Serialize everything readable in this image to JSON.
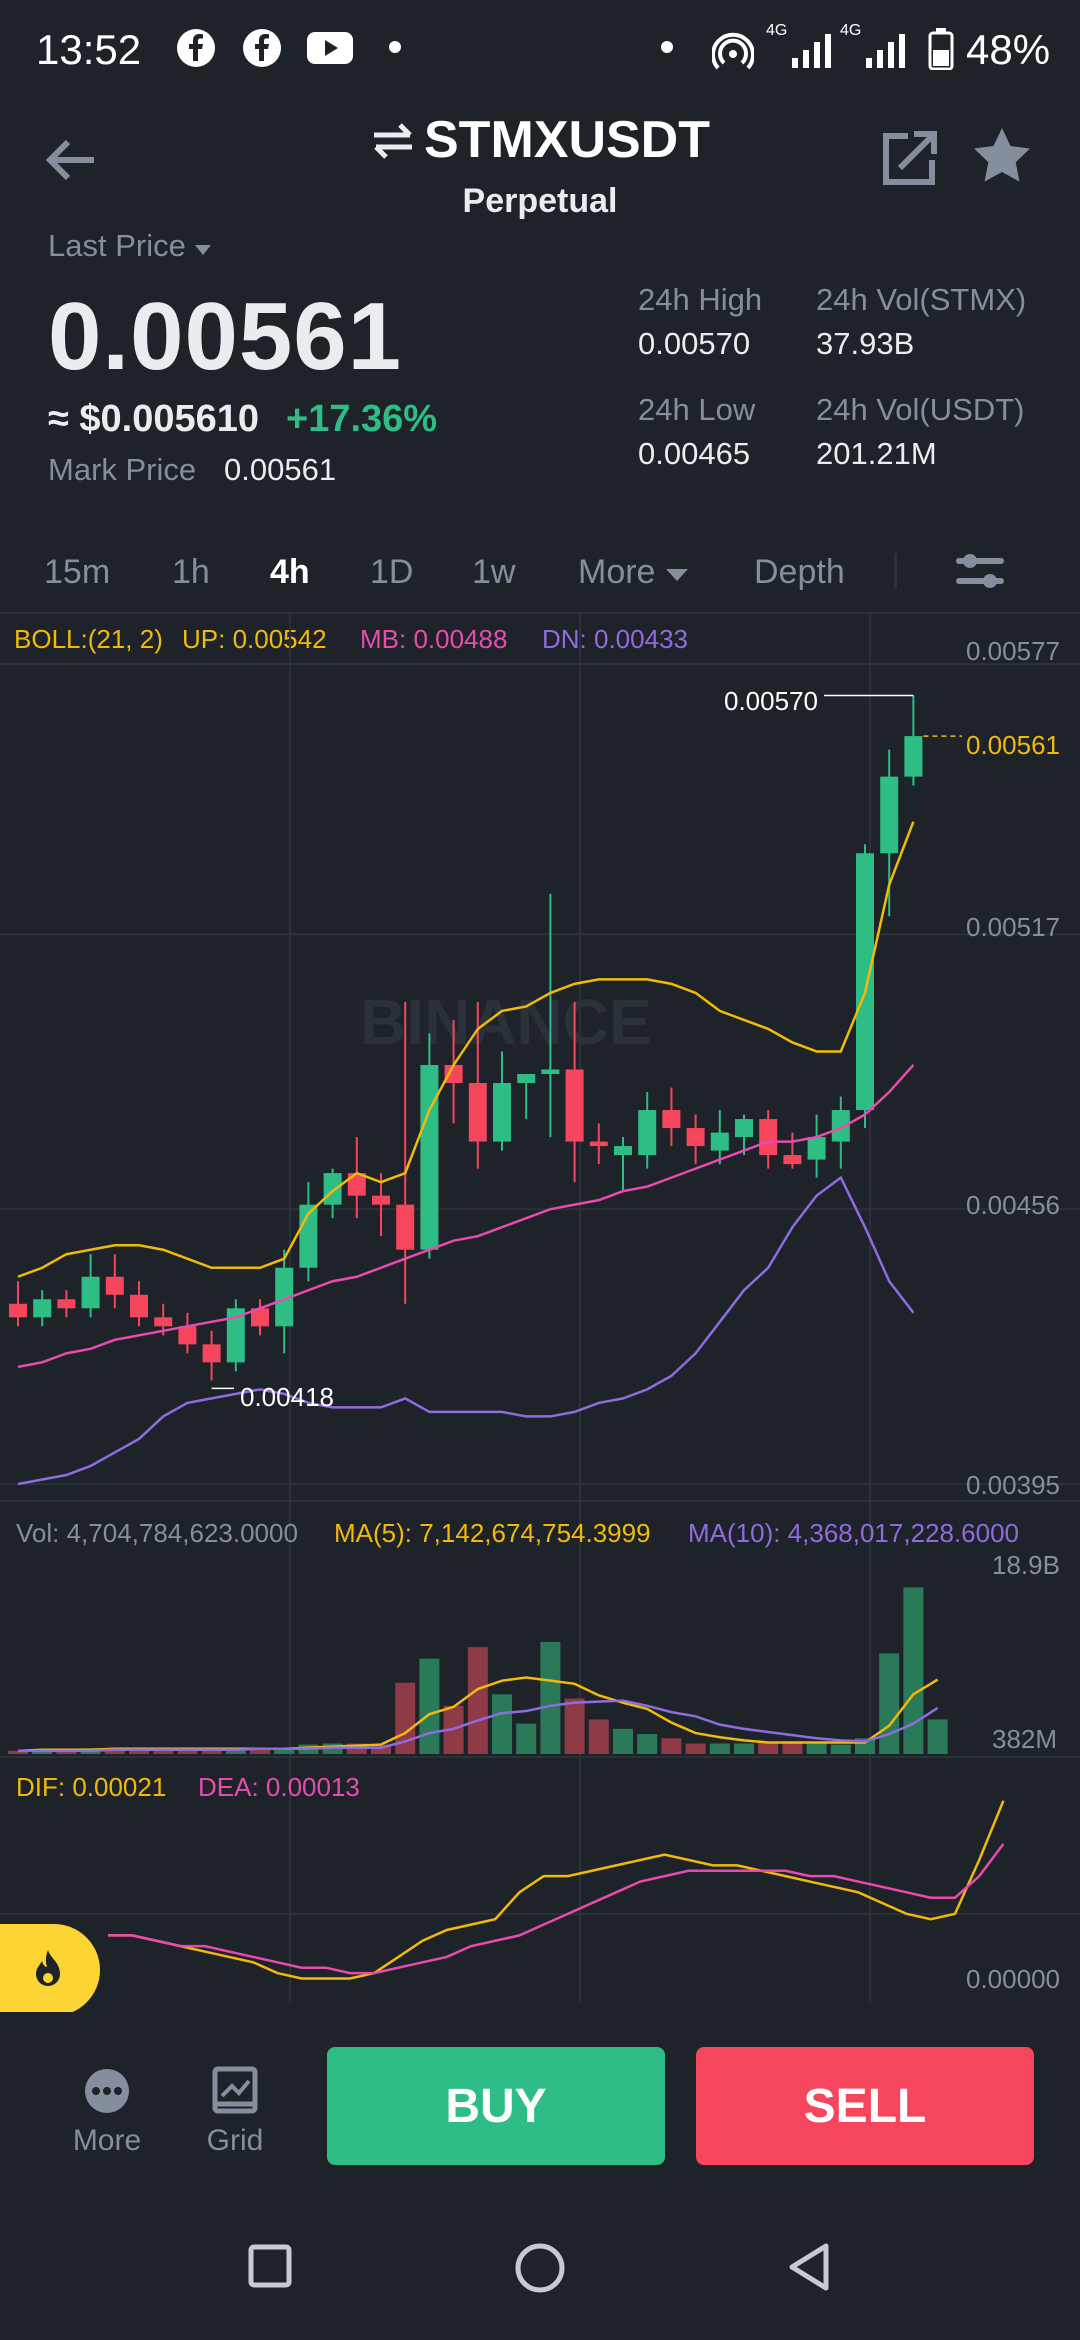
{
  "status_bar": {
    "time": "13:52",
    "battery": "48%",
    "net1": "4G",
    "net2": "4G"
  },
  "header": {
    "pair": "STMXUSDT",
    "contract": "Perpetual"
  },
  "ticker": {
    "last_price_label": "Last Price",
    "last_price": "0.00561",
    "fiat": "≈ $0.005610",
    "change": "+17.36%",
    "mark_price_label": "Mark Price",
    "mark_price": "0.00561",
    "high_label": "24h High",
    "high": "0.00570",
    "low_label": "24h Low",
    "low": "0.00465",
    "vol_base_label": "24h Vol(STMX)",
    "vol_base": "37.93B",
    "vol_quote_label": "24h Vol(USDT)",
    "vol_quote": "201.21M"
  },
  "intervals": {
    "m15": "15m",
    "h1": "1h",
    "h4": "4h",
    "d1": "1D",
    "w1": "1w",
    "more": "More",
    "depth": "Depth",
    "active": "4h"
  },
  "indicators": {
    "boll": "BOLL:(21, 2)",
    "up": "UP: 0.00542",
    "mb": "MB: 0.00488",
    "dn": "DN: 0.00433",
    "vol": "Vol: 4,704,784,623.0000",
    "ma5": "MA(5): 7,142,674,754.3999",
    "ma10": "MA(10): 4,368,017,228.6000",
    "dif": "DIF: 0.00021",
    "dea": "DEA: 0.00013"
  },
  "watermark": "BINANCE",
  "colors": {
    "up": "#2ebd85",
    "down": "#f6465d",
    "accent": "#fcd535",
    "boll_up": "#f0b90b",
    "boll_mb": "#e84bb0",
    "boll_dn": "#8f6be0"
  },
  "chart_data": {
    "type": "candlestick",
    "price_axis_ticks": [
      "0.00577",
      "0.00517",
      "0.00456",
      "0.00395"
    ],
    "ylim": [
      0.00395,
      0.00577
    ],
    "high_annotation": "0.00570",
    "low_annotation": "0.00418",
    "last_price_tag": "0.00561",
    "candles": [
      {
        "o": 0.00435,
        "h": 0.0044,
        "l": 0.0043,
        "c": 0.00432
      },
      {
        "o": 0.00432,
        "h": 0.00438,
        "l": 0.0043,
        "c": 0.00436
      },
      {
        "o": 0.00436,
        "h": 0.00438,
        "l": 0.00432,
        "c": 0.00434
      },
      {
        "o": 0.00434,
        "h": 0.00446,
        "l": 0.00432,
        "c": 0.00441
      },
      {
        "o": 0.00441,
        "h": 0.00446,
        "l": 0.00434,
        "c": 0.00437
      },
      {
        "o": 0.00437,
        "h": 0.0044,
        "l": 0.0043,
        "c": 0.00432
      },
      {
        "o": 0.00432,
        "h": 0.00435,
        "l": 0.00428,
        "c": 0.0043
      },
      {
        "o": 0.0043,
        "h": 0.00433,
        "l": 0.00424,
        "c": 0.00426
      },
      {
        "o": 0.00426,
        "h": 0.00429,
        "l": 0.00418,
        "c": 0.00422
      },
      {
        "o": 0.00422,
        "h": 0.00436,
        "l": 0.0042,
        "c": 0.00434
      },
      {
        "o": 0.00434,
        "h": 0.00436,
        "l": 0.00428,
        "c": 0.0043
      },
      {
        "o": 0.0043,
        "h": 0.00447,
        "l": 0.00424,
        "c": 0.00443
      },
      {
        "o": 0.00443,
        "h": 0.00462,
        "l": 0.0044,
        "c": 0.00457
      },
      {
        "o": 0.00457,
        "h": 0.00465,
        "l": 0.00454,
        "c": 0.00464
      },
      {
        "o": 0.00464,
        "h": 0.00472,
        "l": 0.00454,
        "c": 0.00459
      },
      {
        "o": 0.00459,
        "h": 0.00464,
        "l": 0.0045,
        "c": 0.00457
      },
      {
        "o": 0.00457,
        "h": 0.00502,
        "l": 0.00435,
        "c": 0.00447
      },
      {
        "o": 0.00447,
        "h": 0.00495,
        "l": 0.00445,
        "c": 0.00488
      },
      {
        "o": 0.00488,
        "h": 0.00498,
        "l": 0.00475,
        "c": 0.00484
      },
      {
        "o": 0.00484,
        "h": 0.00502,
        "l": 0.00465,
        "c": 0.00471
      },
      {
        "o": 0.00471,
        "h": 0.00491,
        "l": 0.00469,
        "c": 0.00484
      },
      {
        "o": 0.00484,
        "h": 0.00486,
        "l": 0.00476,
        "c": 0.00486
      },
      {
        "o": 0.00486,
        "h": 0.00526,
        "l": 0.00472,
        "c": 0.00487
      },
      {
        "o": 0.00487,
        "h": 0.00502,
        "l": 0.00462,
        "c": 0.00471
      },
      {
        "o": 0.00471,
        "h": 0.00475,
        "l": 0.00466,
        "c": 0.0047
      },
      {
        "o": 0.00468,
        "h": 0.00472,
        "l": 0.0046,
        "c": 0.0047
      },
      {
        "o": 0.00468,
        "h": 0.00482,
        "l": 0.00465,
        "c": 0.00478
      },
      {
        "o": 0.00478,
        "h": 0.00483,
        "l": 0.0047,
        "c": 0.00474
      },
      {
        "o": 0.00474,
        "h": 0.00477,
        "l": 0.00466,
        "c": 0.0047
      },
      {
        "o": 0.00469,
        "h": 0.00478,
        "l": 0.00466,
        "c": 0.00473
      },
      {
        "o": 0.00472,
        "h": 0.00477,
        "l": 0.00468,
        "c": 0.00476
      },
      {
        "o": 0.00476,
        "h": 0.00478,
        "l": 0.00465,
        "c": 0.00468
      },
      {
        "o": 0.00468,
        "h": 0.00473,
        "l": 0.00465,
        "c": 0.00466
      },
      {
        "o": 0.00467,
        "h": 0.00477,
        "l": 0.00463,
        "c": 0.00472
      },
      {
        "o": 0.00471,
        "h": 0.00481,
        "l": 0.00465,
        "c": 0.00478
      },
      {
        "o": 0.00478,
        "h": 0.00537,
        "l": 0.00474,
        "c": 0.00535
      },
      {
        "o": 0.00535,
        "h": 0.00558,
        "l": 0.00521,
        "c": 0.00552
      },
      {
        "o": 0.00552,
        "h": 0.0057,
        "l": 0.0055,
        "c": 0.00561
      }
    ],
    "boll_up": [
      0.00441,
      0.00443,
      0.00446,
      0.00447,
      0.00448,
      0.00448,
      0.00447,
      0.00445,
      0.00443,
      0.00443,
      0.00443,
      0.00445,
      0.00455,
      0.0046,
      0.00464,
      0.00462,
      0.00464,
      0.00478,
      0.00488,
      0.00496,
      0.005,
      0.00501,
      0.00504,
      0.00506,
      0.00507,
      0.00507,
      0.00507,
      0.00506,
      0.00504,
      0.005,
      0.00498,
      0.00496,
      0.00493,
      0.00491,
      0.00491,
      0.00504,
      0.00528,
      0.00542
    ],
    "boll_mb": [
      0.00421,
      0.00422,
      0.00424,
      0.00425,
      0.00427,
      0.00428,
      0.00429,
      0.0043,
      0.00431,
      0.00432,
      0.00434,
      0.00436,
      0.00438,
      0.0044,
      0.00441,
      0.00443,
      0.00445,
      0.00447,
      0.00449,
      0.0045,
      0.00452,
      0.00454,
      0.00456,
      0.00457,
      0.00458,
      0.0046,
      0.00461,
      0.00463,
      0.00465,
      0.00467,
      0.00469,
      0.00471,
      0.00471,
      0.00472,
      0.00474,
      0.00477,
      0.00482,
      0.00488
    ],
    "boll_dn": [
      0.00395,
      0.00396,
      0.00397,
      0.00399,
      0.00402,
      0.00405,
      0.0041,
      0.00413,
      0.00414,
      0.00415,
      0.00416,
      0.00415,
      0.00413,
      0.00412,
      0.00412,
      0.00412,
      0.00414,
      0.00411,
      0.00411,
      0.00411,
      0.00411,
      0.0041,
      0.0041,
      0.00411,
      0.00413,
      0.00414,
      0.00416,
      0.00419,
      0.00424,
      0.00431,
      0.00438,
      0.00443,
      0.00452,
      0.00459,
      0.00463,
      0.00452,
      0.0044,
      0.00433
    ],
    "volume_axis_ticks": [
      "18.9B",
      "382M"
    ],
    "volume": [
      0.3,
      0.35,
      0.35,
      0.55,
      0.55,
      0.45,
      0.45,
      0.4,
      0.45,
      0.5,
      0.45,
      0.6,
      0.9,
      1.0,
      1.0,
      0.9,
      6.8,
      9.1,
      4.6,
      10.2,
      5.7,
      2.9,
      10.7,
      5.3,
      3.3,
      2.4,
      1.9,
      1.5,
      1.0,
      1.0,
      1.0,
      1.1,
      1.1,
      1.0,
      0.9,
      1.5,
      9.6,
      15.9,
      3.3
    ],
    "vol_ma5": [
      0.3,
      0.4,
      0.4,
      0.4,
      0.5,
      0.5,
      0.5,
      0.5,
      0.5,
      0.5,
      0.5,
      0.5,
      0.6,
      0.7,
      0.8,
      0.9,
      2.0,
      3.8,
      4.5,
      6.2,
      7.0,
      7.3,
      7.0,
      6.7,
      5.6,
      4.9,
      4.3,
      3.0,
      2.0,
      1.6,
      1.3,
      1.1,
      1.1,
      1.1,
      1.1,
      1.1,
      2.7,
      5.7,
      7.1
    ],
    "vol_ma10": [
      0.3,
      0.3,
      0.3,
      0.3,
      0.4,
      0.4,
      0.4,
      0.4,
      0.4,
      0.4,
      0.5,
      0.5,
      0.5,
      0.6,
      0.6,
      0.6,
      1.2,
      2.0,
      2.4,
      3.2,
      3.9,
      4.1,
      4.6,
      4.9,
      5.0,
      5.1,
      4.6,
      4.0,
      3.6,
      2.8,
      2.4,
      2.1,
      1.8,
      1.5,
      1.3,
      1.2,
      1.9,
      2.9,
      4.4
    ],
    "macd_axis_ticks": [
      "0.00000"
    ],
    "dif": [
      -4e-05,
      -4e-05,
      -5e-05,
      -6e-05,
      -7e-05,
      -8e-05,
      -9e-05,
      -0.00011,
      -0.00012,
      -0.00012,
      -0.00012,
      -0.00011,
      -8e-05,
      -5e-05,
      -3e-05,
      -2e-05,
      -1e-05,
      4e-05,
      7e-05,
      7e-05,
      8e-05,
      9e-05,
      0.0001,
      0.00011,
      0.0001,
      9e-05,
      9e-05,
      8e-05,
      7e-05,
      6e-05,
      5e-05,
      4e-05,
      2e-05,
      0.0,
      -1e-05,
      0.0,
      0.0001,
      0.00021
    ],
    "dea": [
      -4e-05,
      -4e-05,
      -5e-05,
      -6e-05,
      -6e-05,
      -7e-05,
      -8e-05,
      -9e-05,
      -0.0001,
      -0.0001,
      -0.00011,
      -0.00011,
      -0.0001,
      -9e-05,
      -8e-05,
      -6e-05,
      -5e-05,
      -4e-05,
      -2e-05,
      0.0,
      2e-05,
      4e-05,
      6e-05,
      7e-05,
      8e-05,
      8e-05,
      8e-05,
      8e-05,
      8e-05,
      7e-05,
      7e-05,
      6e-05,
      5e-05,
      4e-05,
      3e-05,
      3e-05,
      7e-05,
      0.00013
    ]
  },
  "bottom_bar": {
    "more": "More",
    "grid": "Grid",
    "buy": "BUY",
    "sell": "SELL"
  }
}
